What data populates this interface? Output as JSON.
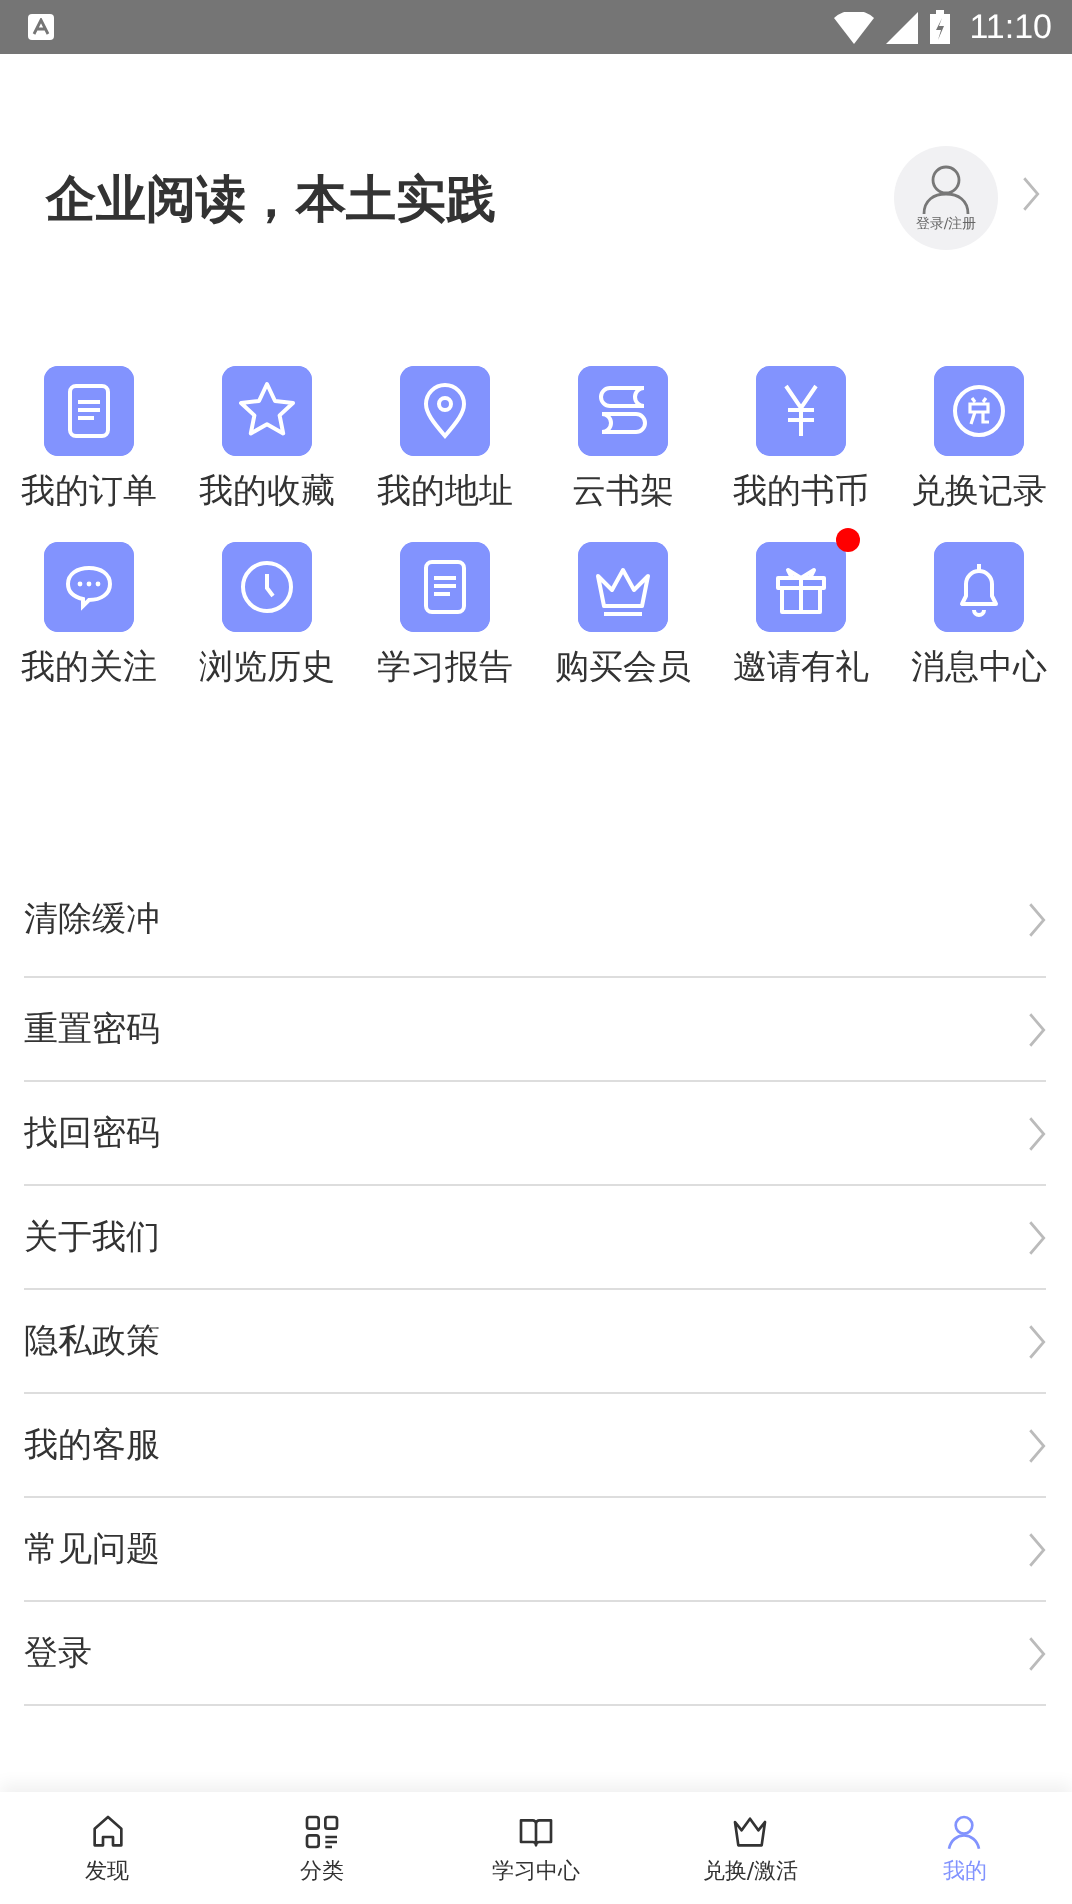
{
  "status_bar": {
    "time": "11:10"
  },
  "header": {
    "title": "企业阅读，本土实践",
    "avatar_label": "登录/注册"
  },
  "shortcuts": [
    {
      "label": "我的订单",
      "dot": false
    },
    {
      "label": "我的收藏",
      "dot": false
    },
    {
      "label": "我的地址",
      "dot": false
    },
    {
      "label": "云书架",
      "dot": false
    },
    {
      "label": "我的书币",
      "dot": false
    },
    {
      "label": "兑换记录",
      "dot": false
    },
    {
      "label": "我的关注",
      "dot": false
    },
    {
      "label": "浏览历史",
      "dot": false
    },
    {
      "label": "学习报告",
      "dot": false
    },
    {
      "label": "购买会员",
      "dot": false
    },
    {
      "label": "邀请有礼",
      "dot": true
    },
    {
      "label": "消息中心",
      "dot": false
    }
  ],
  "menu": [
    "清除缓冲",
    "重置密码",
    "找回密码",
    "关于我们",
    "隐私政策",
    "我的客服",
    "常见问题",
    "登录"
  ],
  "tab_bar": [
    {
      "label": "发现",
      "selected": false
    },
    {
      "label": "分类",
      "selected": false
    },
    {
      "label": "学习中心",
      "selected": false
    },
    {
      "label": "兑换/激活",
      "selected": false
    },
    {
      "label": "我的",
      "selected": true
    }
  ]
}
